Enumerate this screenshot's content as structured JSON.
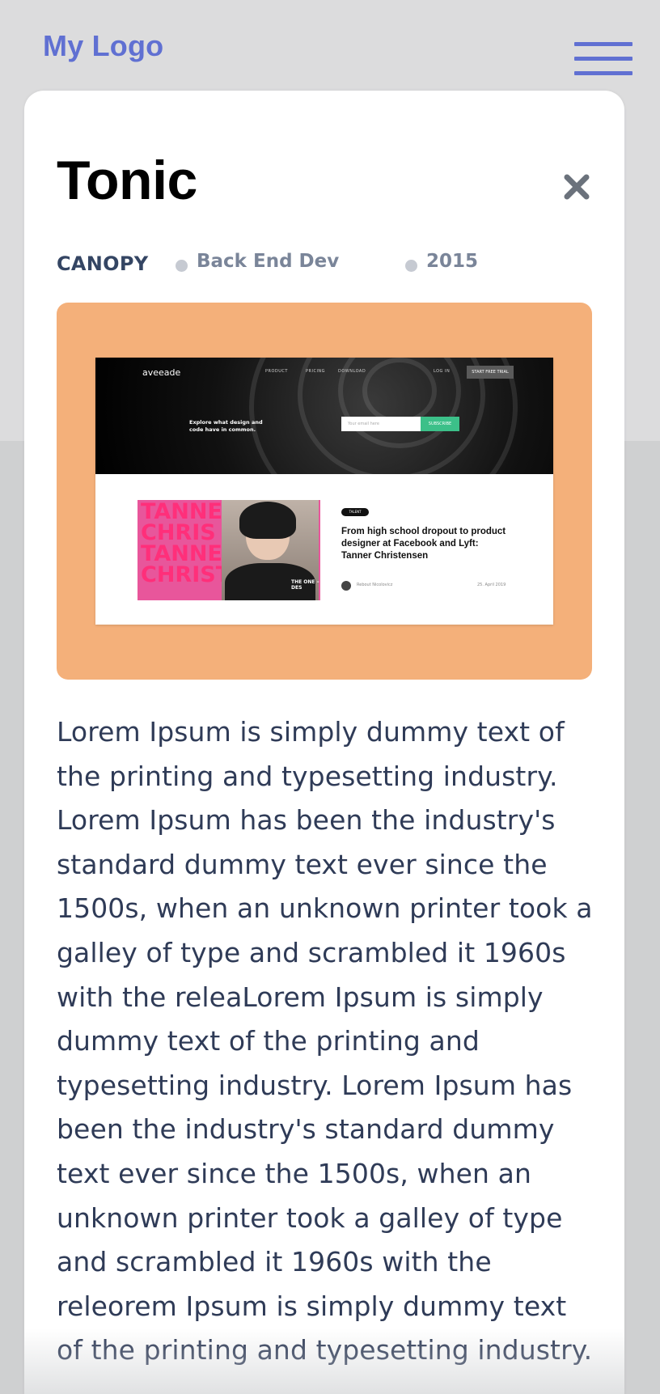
{
  "header": {
    "logo": "My Logo"
  },
  "modal": {
    "title": "Tonic",
    "client": "CANOPY",
    "role": "Back End Dev",
    "year": "2015",
    "description": "Lorem Ipsum is simply dummy text of the printing and typesetting industry. Lorem Ipsum has been the industry's standard dummy text ever since the 1500s, when an unknown printer took a galley of type and scrambled it 1960s with the releaLorem Ipsum is simply dummy text of the printing and typesetting industry. Lorem Ipsum has been the industry's standard dummy text ever since the 1500s, when an unknown printer took a galley of type and scrambled it 1960s with the releorem Ipsum is simply dummy text of the printing and typesetting industry."
  },
  "preview": {
    "brand": "aveeade",
    "nav": [
      "PRODUCT",
      "PRICING",
      "DOWNLOAD",
      "LOG IN"
    ],
    "cta": "START FREE TRIAL",
    "tagline": "Explore what design and code have in common.",
    "input_placeholder": "Your email here",
    "submit": "SUBSCRIBE",
    "feature_text": [
      "TANNE",
      "CHRIS",
      "TANNE",
      "CHRIST"
    ],
    "feature_side": "THE ONE – DES",
    "chip": "TALENT",
    "headline": "From high school dropout to product designer at Facebook and Lyft: Tanner Christensen",
    "author": "Rebout Nicolovicz",
    "date": "25. April 2019"
  },
  "colors": {
    "accent": "#6070d2",
    "preview_bg": "#f4b07a",
    "text": "#2f3b57",
    "page_bg": "#dcdcdd"
  }
}
